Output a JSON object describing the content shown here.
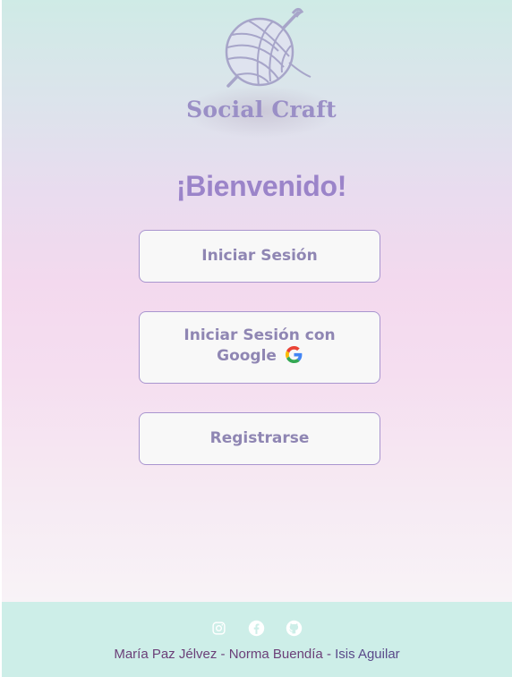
{
  "brand": {
    "name": "Social Craft",
    "logo_icon": "yarn-ball-crochet-hook-icon"
  },
  "welcome": {
    "title": "¡Bienvenido!"
  },
  "buttons": {
    "login": "Iniciar Sesión",
    "google_line1": "Iniciar Sesión con",
    "google_line2": "Google",
    "register": "Registrarse"
  },
  "footer": {
    "social_icons": [
      "instagram-icon",
      "facebook-icon",
      "github-icon"
    ],
    "authors": [
      "María Paz Jélvez",
      "Norma Buendía",
      "Isis Aguilar"
    ],
    "separator": " - "
  },
  "colors": {
    "accent": "#9b84c9",
    "button_border": "#a995cf",
    "footer_bg": "#cdeee8",
    "credits_text": "#6b3f78"
  }
}
